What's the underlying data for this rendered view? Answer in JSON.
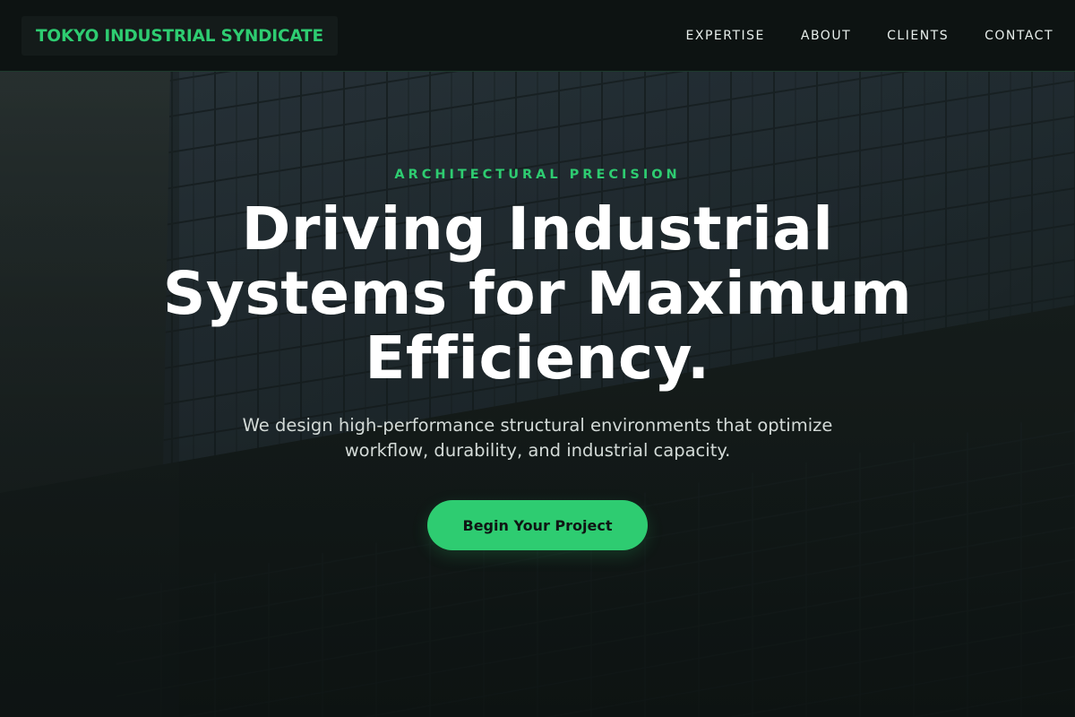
{
  "brand": {
    "name": "TOKYO INDUSTRIAL SYNDICATE",
    "accent_color": "#2ecc71"
  },
  "nav": {
    "items": [
      {
        "label": "EXPERTISE"
      },
      {
        "label": "ABOUT"
      },
      {
        "label": "CLIENTS"
      },
      {
        "label": "CONTACT"
      }
    ]
  },
  "hero": {
    "eyebrow": "ARCHITECTURAL PRECISION",
    "headline": "Driving Industrial Systems for Maximum Efficiency.",
    "subheadline": "We design high-performance structural environments that optimize workflow, durability, and industrial capacity.",
    "cta_label": "Begin Your Project",
    "background_image": "industrial-glass-building-facade"
  }
}
